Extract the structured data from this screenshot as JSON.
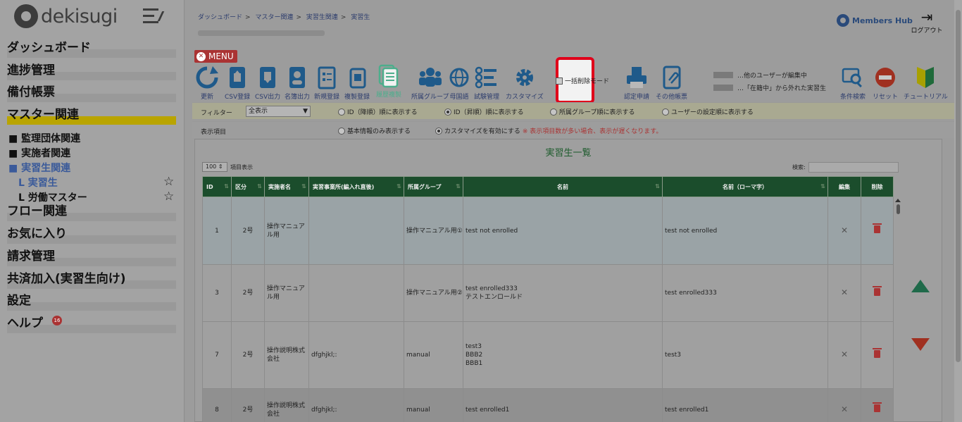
{
  "app": {
    "logo_text": "dekisugi",
    "members_hub": "Members Hub",
    "logout": "ログアウト"
  },
  "sidebar": {
    "items": [
      {
        "label": "ダッシュボード"
      },
      {
        "label": "進捗管理"
      },
      {
        "label": "備付帳票"
      },
      {
        "label": "マスター関連"
      },
      {
        "label": "フロー関連"
      },
      {
        "label": "お気に入り"
      },
      {
        "label": "請求管理"
      },
      {
        "label": "共済加入(実習生向け)"
      },
      {
        "label": "設定"
      },
      {
        "label": "ヘルプ"
      }
    ],
    "sub": [
      {
        "label": "■ 監理団体関連"
      },
      {
        "label": "■ 実施者関連"
      },
      {
        "label": "■ 実習生関連"
      }
    ],
    "subsub": [
      {
        "label": "L 実習生"
      },
      {
        "label": "L 労働マスター"
      }
    ],
    "help_badge": "16"
  },
  "breadcrumb": [
    "ダッシュボード",
    "マスター関連",
    "実習生関連",
    "実習生"
  ],
  "menu_label": "MENU",
  "toolbar": {
    "tools": [
      {
        "label": "更新"
      },
      {
        "label": "CSV登録"
      },
      {
        "label": "CSV出力"
      },
      {
        "label": "名簿出力"
      },
      {
        "label": "新規登録"
      },
      {
        "label": "複製登録"
      },
      {
        "label": "履歴複製"
      },
      {
        "label": "所属グループ"
      },
      {
        "label": "母国語"
      },
      {
        "label": "試験管理"
      },
      {
        "label": "カスタマイズ"
      },
      {
        "label": "認定申請"
      },
      {
        "label": "その他帳票"
      },
      {
        "label": "条件検索"
      },
      {
        "label": "リセット"
      },
      {
        "label": "チュートリアル"
      }
    ],
    "bulk_delete": "一括削除モード",
    "legend_editing": "…他のユーザーが編集中",
    "legend_left": "…「在籍中」から外れた実習生"
  },
  "filter": {
    "label": "フィルター",
    "select_value": "全表示",
    "options": [
      "ID（降順）順に表示する",
      "ID（昇順）順に表示する",
      "所属グループ順に表示する",
      "ユーザーの設定順に表示する"
    ],
    "display_label": "表示項目",
    "display_options": [
      "基本情報のみ表示する",
      "カスタマイズを有効にする"
    ],
    "display_warning": "※ 表示項目数が多い場合、表示が遅くなります。"
  },
  "panel": {
    "title": "実習生一覧",
    "perpage_value": "100",
    "perpage_label": "項目表示",
    "search_label": "検索:"
  },
  "table": {
    "headers": [
      "ID",
      "区分",
      "実施者名",
      "実習事業所(編入れ直後)",
      "所属グループ",
      "名前",
      "名前（ローマ字）",
      "編集",
      "削除"
    ],
    "rows": [
      {
        "id": "1",
        "kubun": "2号",
        "jisshi": "操作マニュアル用",
        "office": "",
        "group": "操作マニュアル用①",
        "name": "test not enrolled",
        "roma": "test not enrolled"
      },
      {
        "id": "3",
        "kubun": "2号",
        "jisshi": "操作マニュアル用",
        "office": "",
        "group": "操作マニュアル用②",
        "name": "test enrolled333\nテストエンロールド",
        "roma": "test enrolled333"
      },
      {
        "id": "7",
        "kubun": "2号",
        "jisshi": "操作説明株式会社",
        "office": "dfghjkl;:",
        "group": "manual",
        "name": "test3\nBBB2\nBBB1",
        "roma": "test3"
      },
      {
        "id": "8",
        "kubun": "2号",
        "jisshi": "操作説明株式会社",
        "office": "dfghjkl;:",
        "group": "manual",
        "name": "test enrolled1",
        "roma": "test enrolled1"
      }
    ]
  },
  "colors": {
    "header_green": "#1b4d2c",
    "highlight_red": "#e0001a",
    "active_bar": "#b9a400"
  }
}
